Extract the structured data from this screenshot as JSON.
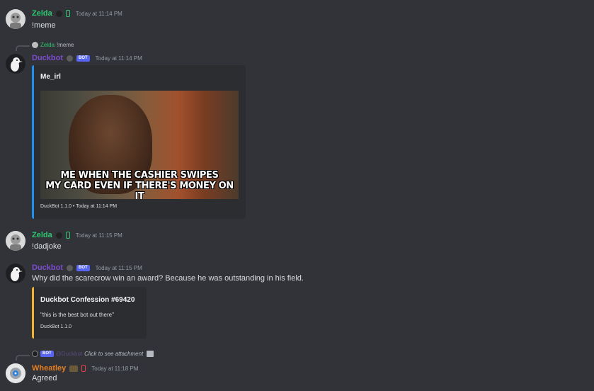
{
  "messages": [
    {
      "author": "Zelda",
      "author_color": "#2dc770",
      "timestamp": "Today at 11:14 PM",
      "content": "!meme"
    },
    {
      "reply": {
        "author": "Zelda",
        "text": "!meme"
      },
      "author": "Duckbot",
      "author_color": "#7c4dcc",
      "badge": "BOT",
      "timestamp": "Today at 11:14 PM",
      "embed": {
        "accent": "#1f8ff0",
        "title": "Me_irl",
        "image_caption_line1": "ME WHEN THE CASHIER SWIPES",
        "image_caption_line2": "MY CARD EVEN IF THERE'S MONEY ON IT",
        "footer": "DuckBot 1.1.0 • Today at 11:14 PM"
      }
    },
    {
      "author": "Zelda",
      "author_color": "#2dc770",
      "timestamp": "Today at 11:15 PM",
      "content": "!dadjoke"
    },
    {
      "author": "Duckbot",
      "author_color": "#7c4dcc",
      "badge": "BOT",
      "timestamp": "Today at 11:15 PM",
      "content": "Why did the scarecrow win an award? Because he was outstanding in his field.",
      "embed": {
        "accent": "#f0b232",
        "title": "Duckbot Confession #69420",
        "description": "\"this is the best bot out there\"",
        "footer": "DuckBot 1.1.0"
      }
    },
    {
      "reply": {
        "badge": "BOT",
        "author": "@Duckbot",
        "text": "Click to see attachment"
      },
      "author": "Wheatley",
      "author_color": "#e67e22",
      "timestamp": "Today at 11:18 PM",
      "content": "Agreed"
    }
  ]
}
